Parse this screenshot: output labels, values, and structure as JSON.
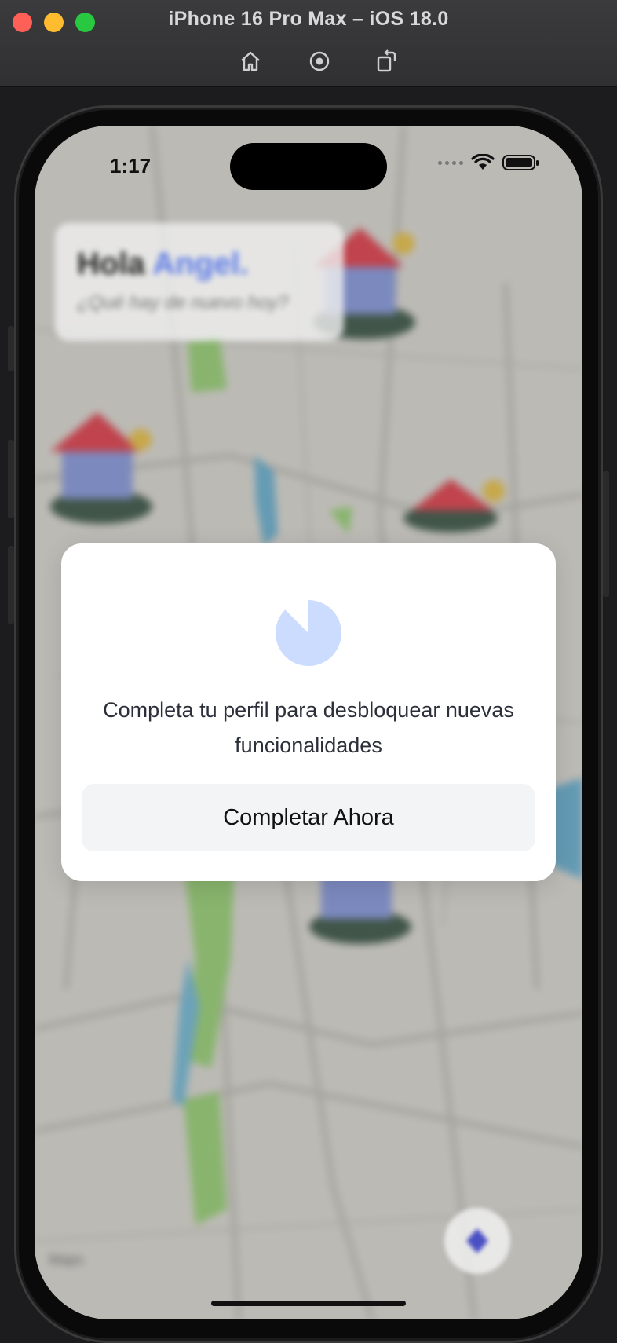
{
  "window": {
    "title": "iPhone 16 Pro Max – iOS 18.0"
  },
  "toolbar": {
    "icons": [
      "home-icon",
      "screenshot-icon",
      "rotate-icon"
    ]
  },
  "status_bar": {
    "time": "1:17"
  },
  "greeting": {
    "hello": "Hola",
    "name": "Angel.",
    "subtitle": "¿Qué hay de nuevo hoy?"
  },
  "modal": {
    "icon": "pie-progress-icon",
    "message": "Completa tu perfil para desbloquear nuevas funcionalidades",
    "button_label": "Completar Ahora"
  },
  "colors": {
    "accent": "#5b7ae6",
    "pie_light": "#ccdcff",
    "map_park": "#8ec96a",
    "map_water": "#5ea7c9",
    "marker_roof": "#d8323f"
  }
}
